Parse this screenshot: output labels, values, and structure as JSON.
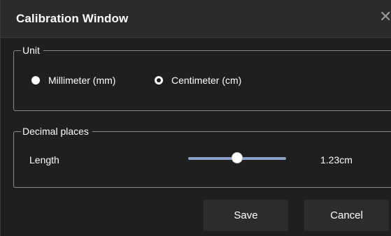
{
  "window": {
    "title": "Calibration Window",
    "close_icon": "close-icon"
  },
  "unit_group": {
    "legend": "Unit",
    "options": [
      {
        "label": "Millimeter (mm)",
        "selected": false
      },
      {
        "label": "Centimeter (cm)",
        "selected": true
      }
    ]
  },
  "decimal_group": {
    "legend": "Decimal places",
    "length_label": "Length",
    "slider_level": 0.5,
    "value_text": "1.23cm"
  },
  "buttons": {
    "save_label": "Save",
    "cancel_label": "Cancel"
  },
  "colors": {
    "background": "#1f1f1f",
    "titlebar": "#2b2b2b",
    "button": "#2c2c2c",
    "slider_track": "#8aa2c8",
    "text": "#ffffff"
  }
}
